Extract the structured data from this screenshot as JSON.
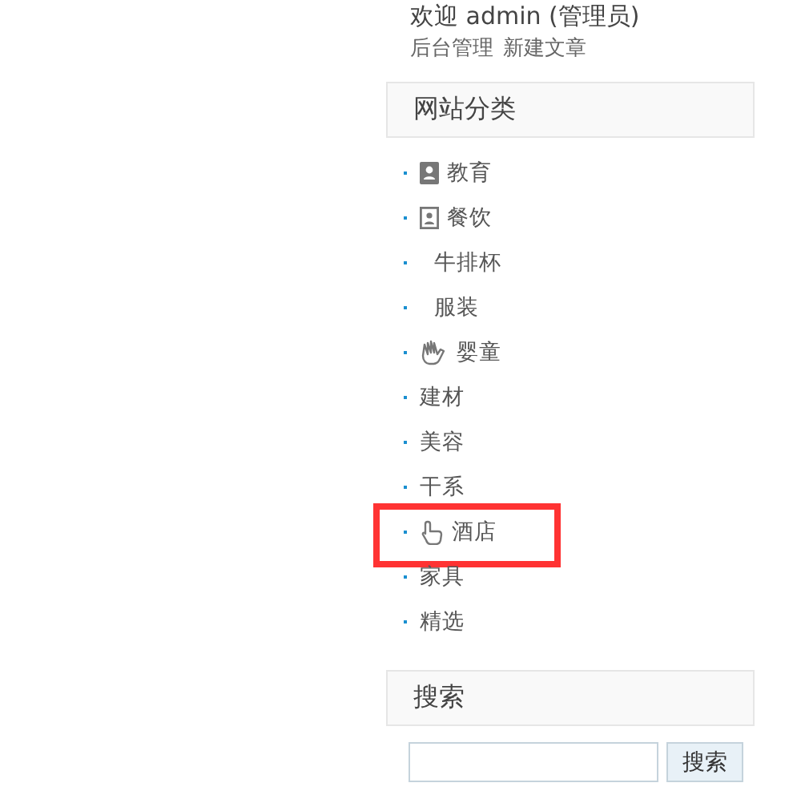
{
  "user": {
    "welcome": "欢迎 admin (管理员)",
    "links": [
      "后台管理",
      "新建文章"
    ]
  },
  "categories": {
    "title": "网站分类",
    "items": [
      {
        "label": "教育",
        "kind": "card",
        "highlighted": false
      },
      {
        "label": "餐饮",
        "kind": "contact",
        "highlighted": false
      },
      {
        "label": "牛排杯",
        "kind": "blank",
        "highlighted": false
      },
      {
        "label": "服装",
        "kind": "blank",
        "highlighted": false
      },
      {
        "label": "婴童",
        "kind": "wave",
        "highlighted": false
      },
      {
        "label": "建材",
        "kind": "plain",
        "highlighted": false
      },
      {
        "label": "美容",
        "kind": "plain",
        "highlighted": false
      },
      {
        "label": "干系",
        "kind": "plain",
        "highlighted": false
      },
      {
        "label": "酒店",
        "kind": "pointer",
        "highlighted": true
      },
      {
        "label": "家具",
        "kind": "plain",
        "highlighted": false
      },
      {
        "label": "精选",
        "kind": "plain",
        "highlighted": false
      }
    ]
  },
  "search": {
    "title": "搜索",
    "button": "搜索"
  }
}
